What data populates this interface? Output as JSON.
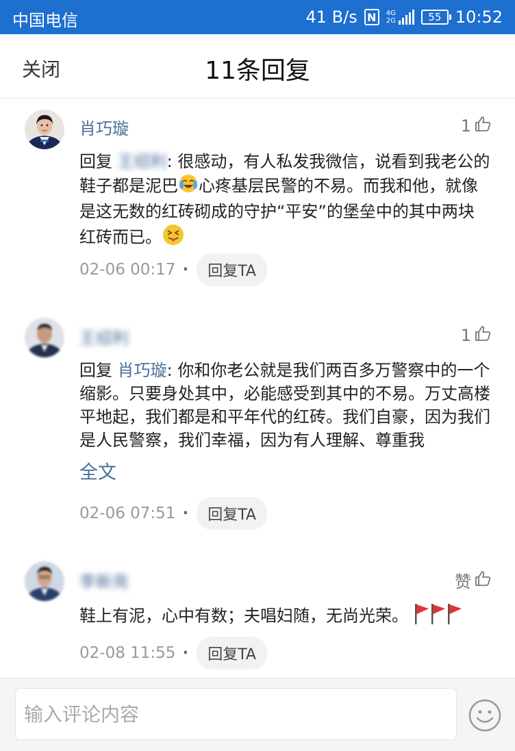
{
  "status_bar": {
    "carrier": "中国电信",
    "speed": "41 B/s",
    "nfc": "N",
    "network_top": "4G",
    "network_bottom": "2G",
    "battery": "55",
    "time": "10:52"
  },
  "header": {
    "close_label": "关闭",
    "title": "11条回复"
  },
  "comments": [
    {
      "author": "肖巧璇",
      "likes": "1",
      "reply_prefix": "回复",
      "mention": "王绍利",
      "text_part1": ": 很感动，有人私发我微信，说看到我老公的鞋子都是泥巴",
      "text_part2": "心疼基层民警的不易。而我和他，就像是这无数的红砖砌成的守护“平安”的堡垒中的其中两块红砖而已。",
      "time": "02-06 00:17",
      "reply_label": "回复TA"
    },
    {
      "author": "王绍利",
      "likes": "1",
      "reply_prefix": "回复",
      "mention": "肖巧璇",
      "text": ": 你和你老公就是我们两百多万警察中的一个缩影。只要身处其中，必能感受到其中的不易。万丈高楼平地起，我们都是和平年代的红砖。我们自豪，因为我们是人民警察，我们幸福，因为有人理解、尊重我",
      "full_text_label": "全文",
      "time": "02-06 07:51",
      "reply_label": "回复TA"
    },
    {
      "author": "李新亮",
      "likes": "赞",
      "text": "鞋上有泥，心中有数；夫唱妇随，无尚光荣。",
      "time": "02-08 11:55",
      "reply_label": "回复TA"
    }
  ],
  "input": {
    "placeholder": "输入评论内容"
  },
  "icons": {
    "like": "thumbs-up-icon",
    "emoji_button": "smiley-icon",
    "flag": "red-flag-icon",
    "cry": "crying-laughing-emoji",
    "tongue": "squint-tongue-emoji"
  },
  "colors": {
    "status_bar": "#1d6fd0",
    "name": "#4a6e9b",
    "flag": "#e0343a"
  }
}
